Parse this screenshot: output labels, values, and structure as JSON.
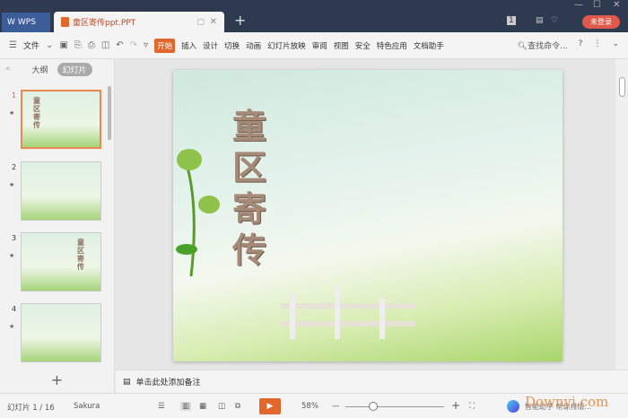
{
  "titlebar": {
    "wps_tab": "WPS",
    "doc_tab": "童区寄传ppt.PPT",
    "new_tab": "+",
    "login": "未登录",
    "badge": "1"
  },
  "toolbar": {
    "file": "文件",
    "menus": [
      "开始",
      "插入",
      "设计",
      "切换",
      "动画",
      "幻灯片放映",
      "审阅",
      "视图",
      "安全",
      "特色应用",
      "文档助手"
    ],
    "active_menu": "开始",
    "search": "查找命令...",
    "help": "?"
  },
  "sidebar": {
    "outline_tab": "大纲",
    "slides_tab": "幻灯片",
    "thumbnails": [
      {
        "num": "1",
        "title": "童区寄传"
      },
      {
        "num": "2",
        "title": ""
      },
      {
        "num": "3",
        "title": "童区寄传"
      },
      {
        "num": "4",
        "title": ""
      }
    ]
  },
  "slide": {
    "title": "童区寄传"
  },
  "notes": {
    "placeholder": "单击此处添加备注"
  },
  "status": {
    "slide_counter": "幻灯片 1 / 16",
    "theme": "Sakura",
    "zoom": "58%",
    "zoom_level": 0.4,
    "watermark": "Downyi.com",
    "assistant": "智能助手 帮你排版..."
  },
  "colors": {
    "accent": "#e2672d",
    "titlebar": "#2e3a4f",
    "login": "#e05a4b"
  }
}
